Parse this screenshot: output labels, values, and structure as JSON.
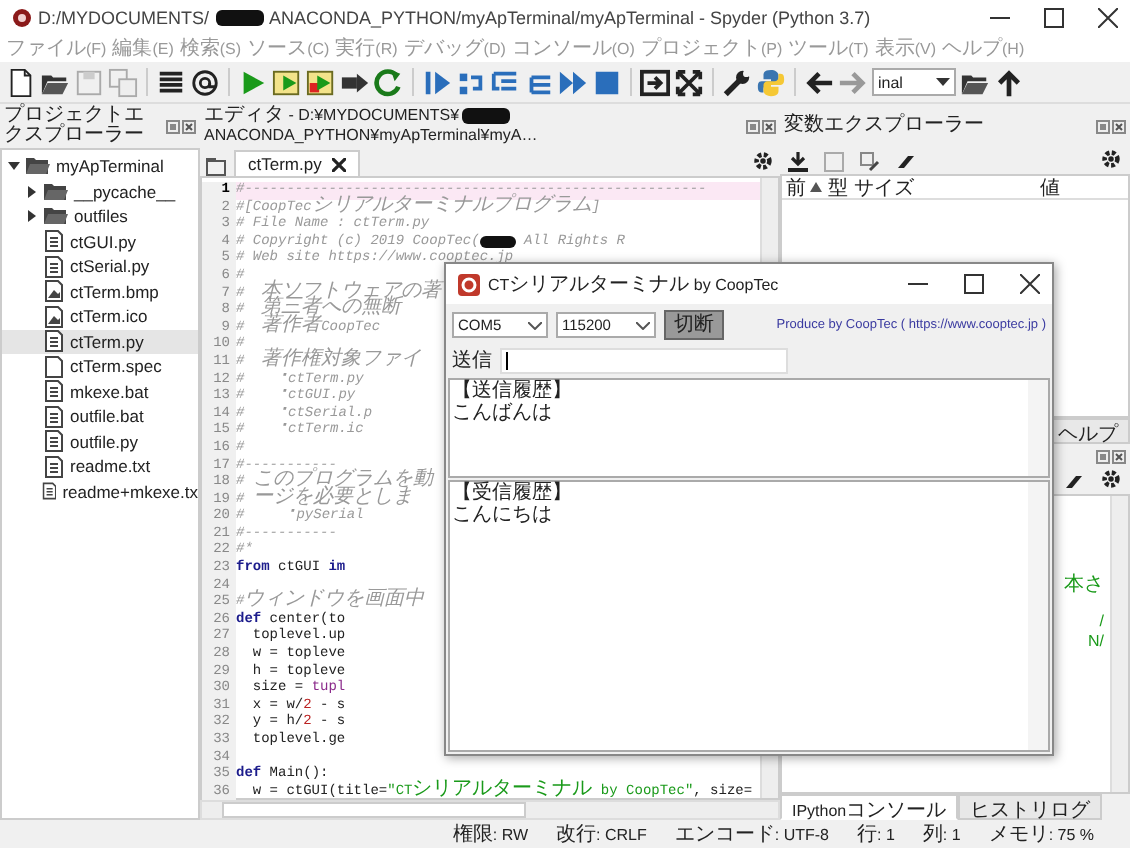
{
  "window": {
    "title_before": "D:/MYDOCUMENTS/",
    "title_after": "ANACONDA_PYTHON/myApTerminal/myApTerminal - Spyder (Python 3.7)"
  },
  "menu": [
    "ファイル(F)",
    "編集(E)",
    "検索(S)",
    "ソース(C)",
    "実行(R)",
    "デバッグ(D)",
    "コンソール(O)",
    "プロジェクト(P)",
    "ツール(T)",
    "表示(V)",
    "ヘルプ(H)"
  ],
  "toolbar": {
    "combo_value": "inal"
  },
  "project": {
    "title": "プロジェクトエクスプローラー",
    "tree": [
      {
        "label": "myApTerminal",
        "kind": "folder",
        "expanded": true,
        "selected": false,
        "children": [
          {
            "label": "__pycache__",
            "kind": "folder",
            "expanded": false,
            "selected": false
          },
          {
            "label": "outfiles",
            "kind": "folder",
            "expanded": false,
            "selected": false
          },
          {
            "label": "ctGUI.py",
            "kind": "text-file",
            "selected": false
          },
          {
            "label": "ctSerial.py",
            "kind": "text-file",
            "selected": false
          },
          {
            "label": "ctTerm.bmp",
            "kind": "image-file",
            "selected": false
          },
          {
            "label": "ctTerm.ico",
            "kind": "image-file",
            "selected": false
          },
          {
            "label": "ctTerm.py",
            "kind": "text-file",
            "selected": true
          },
          {
            "label": "ctTerm.spec",
            "kind": "plain-file",
            "selected": false
          },
          {
            "label": "mkexe.bat",
            "kind": "text-file",
            "selected": false
          },
          {
            "label": "outfile.bat",
            "kind": "text-file",
            "selected": false
          },
          {
            "label": "outfile.py",
            "kind": "text-file",
            "selected": false
          },
          {
            "label": "readme.txt",
            "kind": "text-file",
            "selected": false
          },
          {
            "label": "readme+mkexe.tx",
            "kind": "text-file",
            "selected": false
          }
        ]
      }
    ]
  },
  "editor": {
    "title_before": "エディタ - D:¥MYDOCUMENTS¥",
    "title_after": "ANACONDA_PYTHON¥myApTerminal¥myA…",
    "tabs": [
      {
        "label": "ctTerm.py",
        "selected": true
      }
    ],
    "lines": [
      {
        "no": "1",
        "current": true,
        "tokens": [
          {
            "kind": "comment",
            "text": "#-------------------------------------------------------"
          }
        ]
      },
      {
        "no": "2",
        "current": false,
        "tokens": [
          {
            "kind": "comment",
            "text": "#[CoopTecシリアルターミナルプログラム]"
          }
        ]
      },
      {
        "no": "3",
        "current": false,
        "tokens": [
          {
            "kind": "comment",
            "text": "# File Name : ctTerm.py"
          }
        ]
      },
      {
        "no": "4",
        "current": false,
        "tokens": [
          {
            "kind": "comment",
            "text": "# Copyright (c) 2019 CoopTec("
          },
          {
            "kind": "redacted"
          },
          {
            "kind": "comment",
            "text": " All Rights R"
          }
        ]
      },
      {
        "no": "5",
        "current": false,
        "tokens": [
          {
            "kind": "comment",
            "text": "# Web site https://www.cooptec.jp"
          }
        ]
      },
      {
        "no": "6",
        "current": false,
        "tokens": [
          {
            "kind": "comment",
            "text": "#"
          }
        ]
      },
      {
        "no": "7",
        "current": false,
        "tokens": [
          {
            "kind": "comment",
            "text": "#  本ソフトウェアの著"
          }
        ]
      },
      {
        "no": "8",
        "current": false,
        "tokens": [
          {
            "kind": "comment",
            "text": "#  第三者への無断"
          }
        ]
      },
      {
        "no": "9",
        "current": false,
        "tokens": [
          {
            "kind": "comment",
            "text": "#  著作者CoopTec"
          }
        ]
      },
      {
        "no": "10",
        "current": false,
        "tokens": [
          {
            "kind": "comment",
            "text": "#"
          }
        ]
      },
      {
        "no": "11",
        "current": false,
        "tokens": [
          {
            "kind": "comment",
            "text": "#  著作権対象ファイ"
          }
        ]
      },
      {
        "no": "12",
        "current": false,
        "tokens": [
          {
            "kind": "comment",
            "text": "#    ･ctTerm.py"
          }
        ]
      },
      {
        "no": "13",
        "current": false,
        "tokens": [
          {
            "kind": "comment",
            "text": "#    ･ctGUI.py"
          }
        ]
      },
      {
        "no": "14",
        "current": false,
        "tokens": [
          {
            "kind": "comment",
            "text": "#    ･ctSerial.p"
          }
        ]
      },
      {
        "no": "15",
        "current": false,
        "tokens": [
          {
            "kind": "comment",
            "text": "#    ･ctTerm.ic"
          }
        ]
      },
      {
        "no": "16",
        "current": false,
        "tokens": [
          {
            "kind": "comment",
            "text": "#"
          }
        ]
      },
      {
        "no": "17",
        "current": false,
        "tokens": [
          {
            "kind": "comment",
            "text": "#-----------"
          }
        ]
      },
      {
        "no": "18",
        "current": false,
        "tokens": [
          {
            "kind": "comment",
            "text": "# このプログラムを動"
          }
        ]
      },
      {
        "no": "19",
        "current": false,
        "tokens": [
          {
            "kind": "comment",
            "text": "# ージを必要としま"
          }
        ]
      },
      {
        "no": "20",
        "current": false,
        "tokens": [
          {
            "kind": "comment",
            "text": "#     ･pySerial"
          }
        ]
      },
      {
        "no": "21",
        "current": false,
        "tokens": [
          {
            "kind": "comment",
            "text": "#-----------"
          }
        ]
      },
      {
        "no": "22",
        "current": false,
        "tokens": [
          {
            "kind": "comment",
            "text": "#*"
          }
        ]
      },
      {
        "no": "23",
        "current": false,
        "tokens": [
          {
            "kind": "keyword",
            "text": "from"
          },
          {
            "kind": "plain",
            "text": " ctGUI "
          },
          {
            "kind": "keyword",
            "text": "im"
          }
        ]
      },
      {
        "no": "24",
        "current": false
      },
      {
        "no": "25",
        "current": false,
        "tokens": [
          {
            "kind": "comment",
            "text": "#ウィンドウを画面中"
          }
        ]
      },
      {
        "no": "26",
        "current": false,
        "tokens": [
          {
            "kind": "keyword",
            "text": "def"
          },
          {
            "kind": "plain",
            "text": " center(to"
          }
        ]
      },
      {
        "no": "27",
        "current": false,
        "tokens": [
          {
            "kind": "plain",
            "text": "  toplevel.up"
          }
        ]
      },
      {
        "no": "28",
        "current": false,
        "tokens": [
          {
            "kind": "plain",
            "text": "  w = topleve"
          }
        ]
      },
      {
        "no": "29",
        "current": false,
        "tokens": [
          {
            "kind": "plain",
            "text": "  h = topleve"
          }
        ]
      },
      {
        "no": "30",
        "current": false,
        "tokens": [
          {
            "kind": "plain",
            "text": "  size = "
          },
          {
            "kind": "builtin",
            "text": "tupl"
          }
        ]
      },
      {
        "no": "31",
        "current": false,
        "tokens": [
          {
            "kind": "plain",
            "text": "  x = w/"
          },
          {
            "kind": "number",
            "text": "2"
          },
          {
            "kind": "plain",
            "text": " - s"
          }
        ]
      },
      {
        "no": "32",
        "current": false,
        "tokens": [
          {
            "kind": "plain",
            "text": "  y = h/"
          },
          {
            "kind": "number",
            "text": "2"
          },
          {
            "kind": "plain",
            "text": " - s"
          }
        ]
      },
      {
        "no": "33",
        "current": false,
        "tokens": [
          {
            "kind": "plain",
            "text": "  toplevel.ge"
          }
        ]
      },
      {
        "no": "34",
        "current": false
      },
      {
        "no": "35",
        "current": false,
        "tokens": [
          {
            "kind": "keyword",
            "text": "def"
          },
          {
            "kind": "plain",
            "text": " Main():"
          }
        ]
      },
      {
        "no": "36",
        "current": false,
        "tokens": [
          {
            "kind": "plain",
            "text": "  w = ctGUI(title="
          },
          {
            "kind": "string",
            "text": "\"CTシリアルターミナル by CoopTec\""
          },
          {
            "kind": "plain",
            "text": ", size="
          }
        ]
      }
    ]
  },
  "variables": {
    "title": "変数エクスプローラー",
    "columns": [
      {
        "label": "前",
        "sorted": true
      },
      {
        "label": "型",
        "sorted": false
      },
      {
        "label": "サイズ",
        "sorted": false
      },
      {
        "label": "値",
        "sorted": false
      }
    ]
  },
  "upper_tabs": [
    {
      "label": "ヘルプ",
      "selected": false
    }
  ],
  "console": {
    "lines": [
      "本さ",
      "/",
      "N/"
    ],
    "tabs": [
      {
        "label": "IPythonコンソール",
        "selected": true
      },
      {
        "label": "ヒストリログ",
        "selected": false
      }
    ]
  },
  "terminal": {
    "title": "CTシリアルターミナル by CoopTec",
    "port": "COM5",
    "baud": "115200",
    "disconnect_button": "切断",
    "credit": "Produce by CoopTec ( https://www.cooptec.jp )",
    "send_label": "送信",
    "sent_history": [
      "【送信履歴】",
      "こんばんは"
    ],
    "received_history": [
      "【受信履歴】",
      "こんにちは"
    ]
  },
  "status_bar": [
    "権限: RW",
    "改行: CRLF",
    "エンコード: UTF-8",
    "行: 1",
    "列: 1",
    "メモリ: 75 %"
  ]
}
